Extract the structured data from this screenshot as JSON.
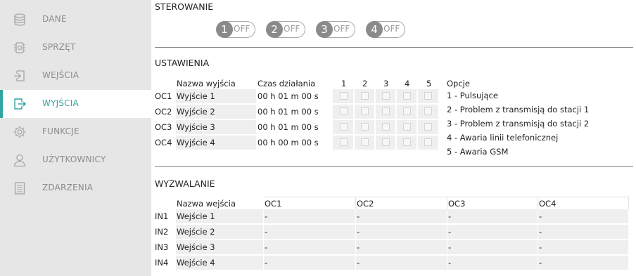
{
  "sidebar": {
    "items": [
      {
        "label": "DANE",
        "icon": "database-icon",
        "active": false
      },
      {
        "label": "SPRZĘT",
        "icon": "chip-icon",
        "active": false
      },
      {
        "label": "WEJŚCIA",
        "icon": "input-icon",
        "active": false
      },
      {
        "label": "WYJŚCIA",
        "icon": "output-icon",
        "active": true
      },
      {
        "label": "FUNKCJE",
        "icon": "gear-icon",
        "active": false
      },
      {
        "label": "UŻYTKOWNICY",
        "icon": "user-icon",
        "active": false
      },
      {
        "label": "ZDARZENIA",
        "icon": "list-icon",
        "active": false
      }
    ],
    "accent_color": "#2fa6a0"
  },
  "sterowanie": {
    "title": "STEROWANIE",
    "toggles": [
      {
        "number": "1",
        "state": "OFF"
      },
      {
        "number": "2",
        "state": "OFF"
      },
      {
        "number": "3",
        "state": "OFF"
      },
      {
        "number": "4",
        "state": "OFF"
      }
    ]
  },
  "ustawienia": {
    "title": "USTAWIENIA",
    "headers": {
      "name": "Nazwa wyjścia",
      "time": "Czas działania",
      "cols": [
        "1",
        "2",
        "3",
        "4",
        "5"
      ]
    },
    "rows": [
      {
        "id": "OC1",
        "name": "Wyjście 1",
        "time": "00 h 01 m 00 s",
        "checks": [
          false,
          false,
          false,
          false,
          false
        ]
      },
      {
        "id": "OC2",
        "name": "Wyjście 2",
        "time": "00 h 01 m 00 s",
        "checks": [
          false,
          false,
          false,
          false,
          false
        ]
      },
      {
        "id": "OC3",
        "name": "Wyjście 3",
        "time": "00 h 01 m 00 s",
        "checks": [
          false,
          false,
          false,
          false,
          false
        ]
      },
      {
        "id": "OC4",
        "name": "Wyjście 4",
        "time": "00 h 00 m 00 s",
        "checks": [
          false,
          false,
          false,
          false,
          false
        ]
      }
    ],
    "options_title": "Opcje",
    "options": [
      "1 - Pulsujące",
      "2 - Problem z transmisją do stacji 1",
      "3 - Problem z transmisją do stacji 2",
      "4 - Awaria linii telefonicznej",
      "5 - Awaria GSM"
    ]
  },
  "wyzwalanie": {
    "title": "WYZWALANIE",
    "headers": {
      "name": "Nazwa wejścia",
      "cols": [
        "OC1",
        "OC2",
        "OC3",
        "OC4"
      ]
    },
    "rows": [
      {
        "id": "IN1",
        "name": "Wejście 1",
        "values": [
          "-",
          "-",
          "-",
          "-"
        ]
      },
      {
        "id": "IN2",
        "name": "Wejście 2",
        "values": [
          "-",
          "-",
          "-",
          "-"
        ]
      },
      {
        "id": "IN3",
        "name": "Wejście 3",
        "values": [
          "-",
          "-",
          "-",
          "-"
        ]
      },
      {
        "id": "IN4",
        "name": "Wejście 4",
        "values": [
          "-",
          "-",
          "-",
          "-"
        ]
      }
    ]
  }
}
